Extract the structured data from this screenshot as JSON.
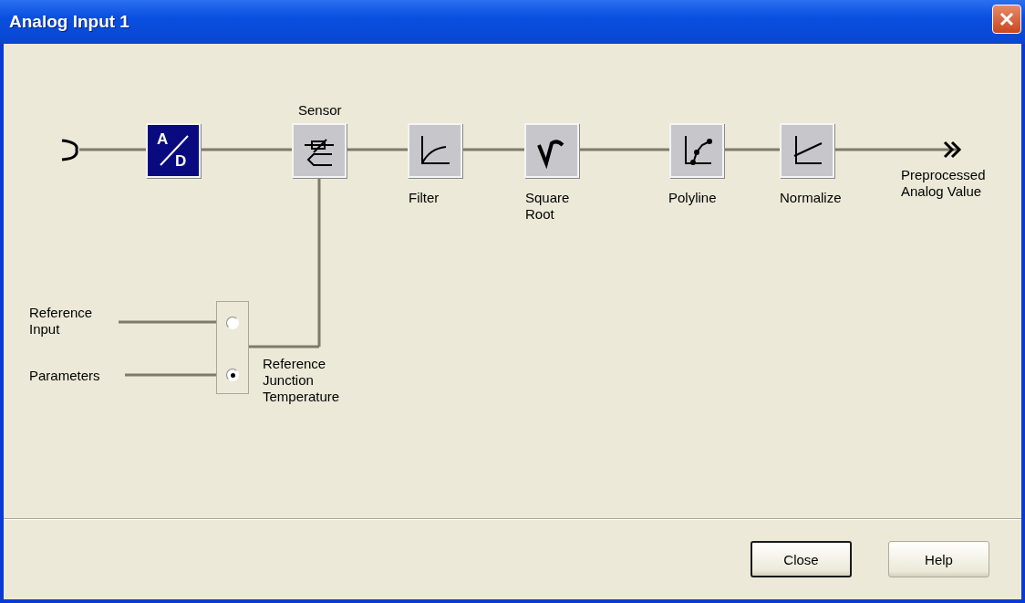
{
  "window": {
    "title": "Analog Input 1"
  },
  "blocks": [
    {
      "kind": "converter",
      "top": "A",
      "bottom": "D"
    },
    {
      "kind": "sensor",
      "label": "Sensor"
    },
    {
      "kind": "filter",
      "label": "Filter"
    },
    {
      "kind": "sqrt",
      "label": "Square Root"
    },
    {
      "kind": "polyline",
      "label": "Polyline"
    },
    {
      "kind": "normalize",
      "label": "Normalize"
    }
  ],
  "output": {
    "label": "Preprocessed Analog Value"
  },
  "reference": {
    "label": "Reference Junction Temperature",
    "options": [
      {
        "label": "Reference Input",
        "selected": false
      },
      {
        "label": "Parameters",
        "selected": true
      }
    ]
  },
  "buttons": [
    {
      "label": "Close",
      "default": true
    },
    {
      "label": "Help",
      "default": false
    }
  ]
}
